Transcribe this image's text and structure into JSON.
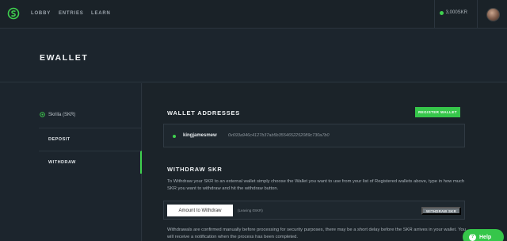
{
  "nav": {
    "links": [
      "LOBBY",
      "ENTRIES",
      "LEARN"
    ],
    "balance": "3,000SKR"
  },
  "page": {
    "title": "EWALLET"
  },
  "sidebar": {
    "currency": "Skrilla (SKR)",
    "items": [
      "DEPOSIT",
      "WITHDRAW"
    ],
    "active": "WITHDRAW"
  },
  "wallets": {
    "title": "WALLET ADDRESSES",
    "register_label": "REGISTER WALLET",
    "entries": [
      {
        "name": "kingjamesmew",
        "address": "0x693a946c4127b37ab5b3554652252089c730a7b0"
      }
    ]
  },
  "withdraw": {
    "title": "WITHDRAW SKR",
    "instructions": "To Withdraw your SKR to an external wallet simply choose the Wallet you want to use from your list of Registered wallets above, type in how much SKR you want to withdraw and hit the withdraw button.",
    "amount_placeholder": "Amount to Withdraw",
    "leaving": "(Leaving 0SKR)",
    "button_label": "WITHDRAW SKR",
    "note": "Withdrawals are confirmed manually before processing for security purposes, there may be a short delay before the SKR arrives in your wallet. You will receive a notification when the process has been completed."
  },
  "help": {
    "label": "Help"
  },
  "colors": {
    "accent": "#36c64a",
    "background": "#1c252d"
  }
}
